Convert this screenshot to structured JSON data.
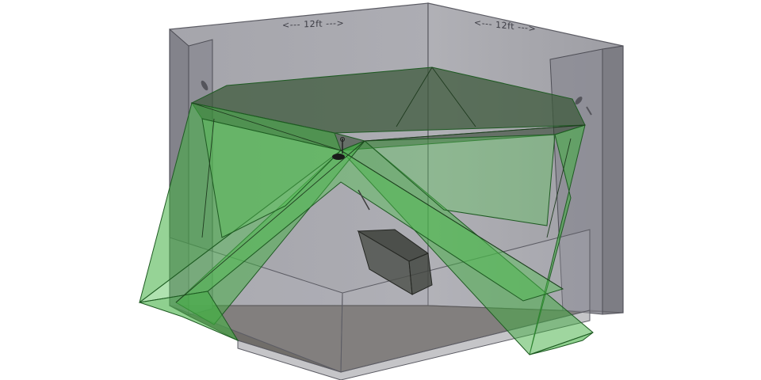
{
  "diagram": {
    "dimensions": {
      "left_wall_label": "<--- 12ft --->",
      "right_wall_label": "<--- 12ft --->"
    },
    "colors": {
      "wall": "#8d8d94",
      "wall_dark": "#6e6e76",
      "floor": "#5d5a57",
      "coverage": "#3fae3f",
      "coverage_edge": "#1e5a22",
      "ceiling_rim": "#3c4a3a"
    }
  }
}
